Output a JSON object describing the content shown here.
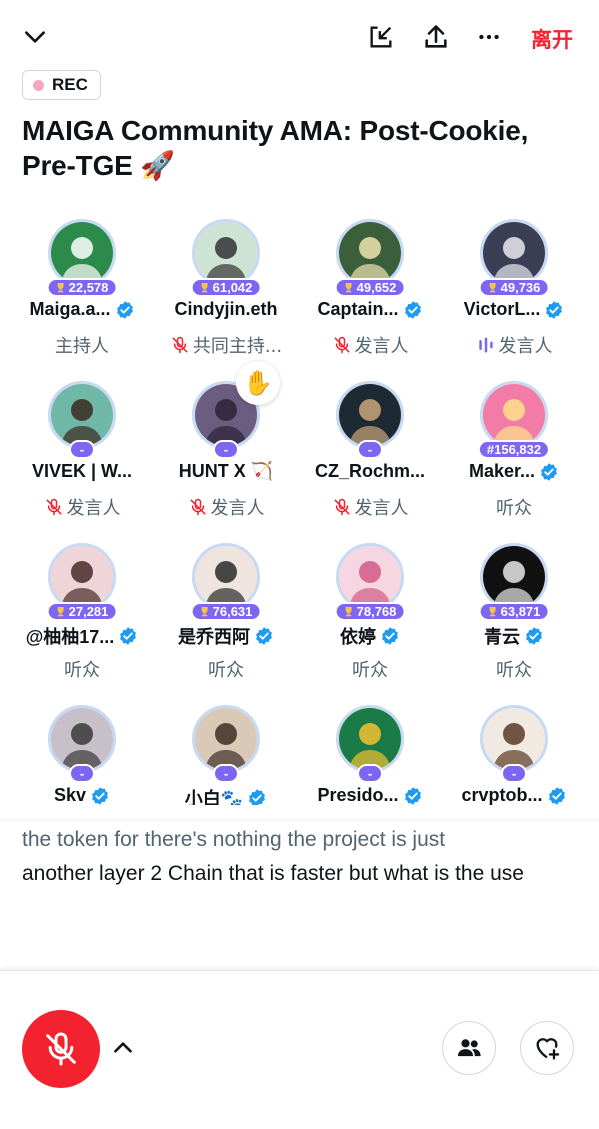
{
  "header": {
    "leave_label": "离开",
    "rec_label": "REC",
    "title": "MAIGA Community AMA: Post-Cookie, Pre-TGE 🚀",
    "colors": {
      "accent_red": "#f4212e",
      "pill_purple": "#7f66f2",
      "verified_blue": "#1d9bf0"
    }
  },
  "participants": [
    {
      "name": "Maiga.a...",
      "badge": "22,578",
      "badge_icon": "trophy-icon",
      "verified": true,
      "role": "主持人",
      "role_icon": "",
      "avatar_desc": "green-cap-icon"
    },
    {
      "name": "Cindyjin.eth",
      "badge": "61,042",
      "badge_icon": "trophy-icon",
      "verified": false,
      "role": "共同主持...",
      "role_icon": "mic-off-icon",
      "avatar_desc": "woman-portrait"
    },
    {
      "name": "Captain...",
      "badge": "49,652",
      "badge_icon": "trophy-icon",
      "verified": true,
      "role": "发言人",
      "role_icon": "mic-off-icon",
      "avatar_desc": "pirate-portrait"
    },
    {
      "name": "VictorL...",
      "badge": "49,736",
      "badge_icon": "trophy-icon",
      "verified": true,
      "role": "发言人",
      "role_icon": "speaking-bars-icon",
      "avatar_desc": "man-suit-portrait"
    },
    {
      "name": "VIVEK | W...",
      "badge": "-",
      "badge_icon": "",
      "verified": false,
      "role": "发言人",
      "role_icon": "mic-off-icon",
      "avatar_desc": "man-illustration"
    },
    {
      "name": "HUNT X 🏹",
      "badge": "-",
      "badge_icon": "",
      "verified": false,
      "role": "发言人",
      "role_icon": "mic-off-icon",
      "avatar_desc": "cat-hood",
      "hand_raised": "✋"
    },
    {
      "name": "CZ_Rochm...",
      "badge": "-",
      "badge_icon": "",
      "verified": false,
      "role": "发言人",
      "role_icon": "mic-off-icon",
      "avatar_desc": "man-long-hair"
    },
    {
      "name": "Maker...",
      "badge": "#156,832",
      "badge_icon": "",
      "verified": true,
      "role": "听众",
      "role_icon": "",
      "avatar_desc": "anime-pink"
    },
    {
      "name": "@柚柚17...",
      "badge": "27,281",
      "badge_icon": "trophy-icon",
      "verified": true,
      "role": "听众",
      "role_icon": "",
      "avatar_desc": "woman-photo"
    },
    {
      "name": "是乔西阿",
      "badge": "76,631",
      "badge_icon": "trophy-icon",
      "verified": true,
      "role": "听众",
      "role_icon": "",
      "avatar_desc": "anime-girl"
    },
    {
      "name": "依婷",
      "badge": "78,768",
      "badge_icon": "trophy-icon",
      "verified": true,
      "role": "听众",
      "role_icon": "",
      "avatar_desc": "pink-illustration"
    },
    {
      "name": "青云",
      "badge": "63,871",
      "badge_icon": "trophy-icon",
      "verified": true,
      "role": "听众",
      "role_icon": "",
      "avatar_desc": "calligraphy-qingyun"
    },
    {
      "name": "Skv",
      "badge": "-",
      "badge_icon": "",
      "verified": true,
      "role": "",
      "role_icon": "",
      "avatar_desc": "anime-couple-cat"
    },
    {
      "name": "小白🐾",
      "badge": "-",
      "badge_icon": "",
      "verified": true,
      "role": "",
      "role_icon": "",
      "avatar_desc": "girl-sunglasses"
    },
    {
      "name": "Presido...",
      "badge": "-",
      "badge_icon": "",
      "verified": true,
      "role": "",
      "role_icon": "",
      "avatar_desc": "green-circle-character"
    },
    {
      "name": "crvptob...",
      "badge": "-",
      "badge_icon": "",
      "verified": true,
      "role": "",
      "role_icon": "",
      "avatar_desc": "man-photo"
    }
  ],
  "caption": {
    "first_line": "the token for there's nothing the project is just",
    "rest": "another layer 2 Chain that is faster but what is the use"
  },
  "bottom": {
    "mic_icon": "mic-off-icon",
    "expand_icon": "chevron-up-icon",
    "people_icon": "people-icon",
    "react_icon": "heart-plus-icon"
  }
}
